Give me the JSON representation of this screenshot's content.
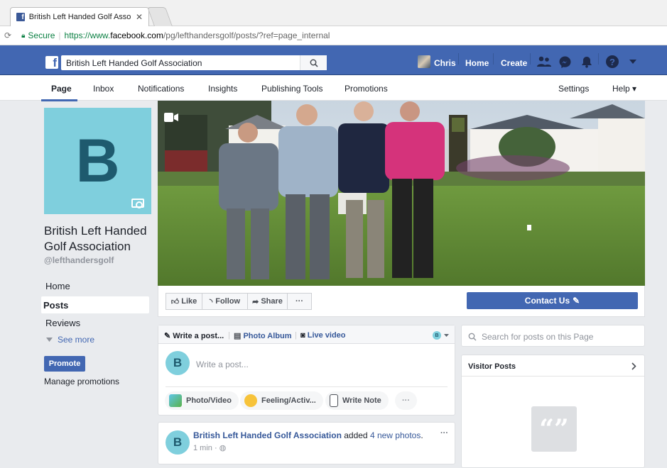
{
  "browser": {
    "tab_title": "British Left Handed Golf Asso",
    "secure_label": "Secure",
    "url_prefix": "https://www.",
    "url_domain": "facebook.com",
    "url_path": "/pg/lefthandersgolf/posts/?ref=page_internal"
  },
  "topbar": {
    "search_value": "British Left Handed Golf Association",
    "user_name": "Chris",
    "home": "Home",
    "create": "Create"
  },
  "page_tabs": {
    "page": "Page",
    "inbox": "Inbox",
    "notifications": "Notifications",
    "insights": "Insights",
    "publishing_tools": "Publishing Tools",
    "promotions": "Promotions",
    "settings": "Settings",
    "help": "Help ▾"
  },
  "sidebar": {
    "profile_letter": "B",
    "page_name": "British Left Handed Golf Association",
    "handle": "@lefthandersgolf",
    "items": [
      {
        "label": "Home"
      },
      {
        "label": "Posts"
      },
      {
        "label": "Reviews"
      }
    ],
    "see_more": "See more",
    "promote": "Promote",
    "manage_promotions": "Manage promotions"
  },
  "actions": {
    "like": "Like",
    "follow": "Follow",
    "share": "Share",
    "more": "···",
    "contact": "Contact Us"
  },
  "composer": {
    "write_post_tab": "Write a post...",
    "photo_album_tab": "Photo Album",
    "live_video_tab": "Live video",
    "avatar_letter": "B",
    "placeholder": "Write a post...",
    "photo_video": "Photo/Video",
    "feeling": "Feeling/Activ...",
    "write_note": "Write Note",
    "more": "···"
  },
  "search_posts": {
    "placeholder": "Search for posts on this Page"
  },
  "visitor_posts": {
    "title": "Visitor Posts"
  },
  "post": {
    "author": "British Left Handed Golf Association",
    "action": " added ",
    "link": "4 new photos",
    "suffix": ".",
    "time": "1 min ·",
    "more": "···"
  },
  "colors": {
    "facebook_blue": "#4267b2",
    "brand_teal": "#7fcfdd",
    "brand_letter": "#1e5a6e"
  }
}
